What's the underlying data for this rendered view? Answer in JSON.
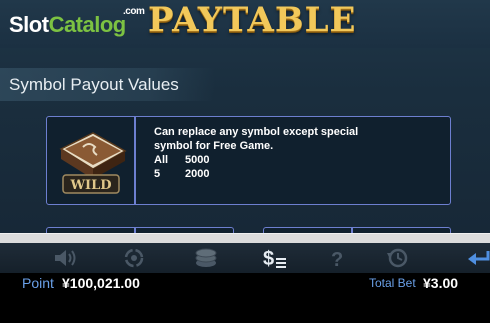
{
  "logo": {
    "slot": "Slot",
    "catalog": "Catalog",
    "dotcom": ".com"
  },
  "title": "PAYTABLE",
  "section_title": "Symbol Payout Values",
  "wild_card": {
    "symbol_label": "WILD",
    "description_line1": "Can replace any symbol except special",
    "description_line2": "symbol for Free Game.",
    "payouts": [
      {
        "count": "All",
        "value": "5000"
      },
      {
        "count": "5",
        "value": "2000"
      }
    ]
  },
  "toolbar": {
    "icons": [
      "sound-icon",
      "autoplay-icon",
      "chips-icon",
      "paytable-icon",
      "help-icon",
      "history-icon",
      "back-icon"
    ],
    "active": "paytable-icon"
  },
  "status": {
    "point_label": "Point",
    "point_value": "¥100,021.00",
    "total_bet_label": "Total Bet",
    "total_bet_value": "¥3.00"
  },
  "colors": {
    "title_gold": "#f2c85a",
    "card_border": "#6d7fd0",
    "status_label_blue": "#6aa0e8",
    "logo_green": "#7cc242"
  }
}
